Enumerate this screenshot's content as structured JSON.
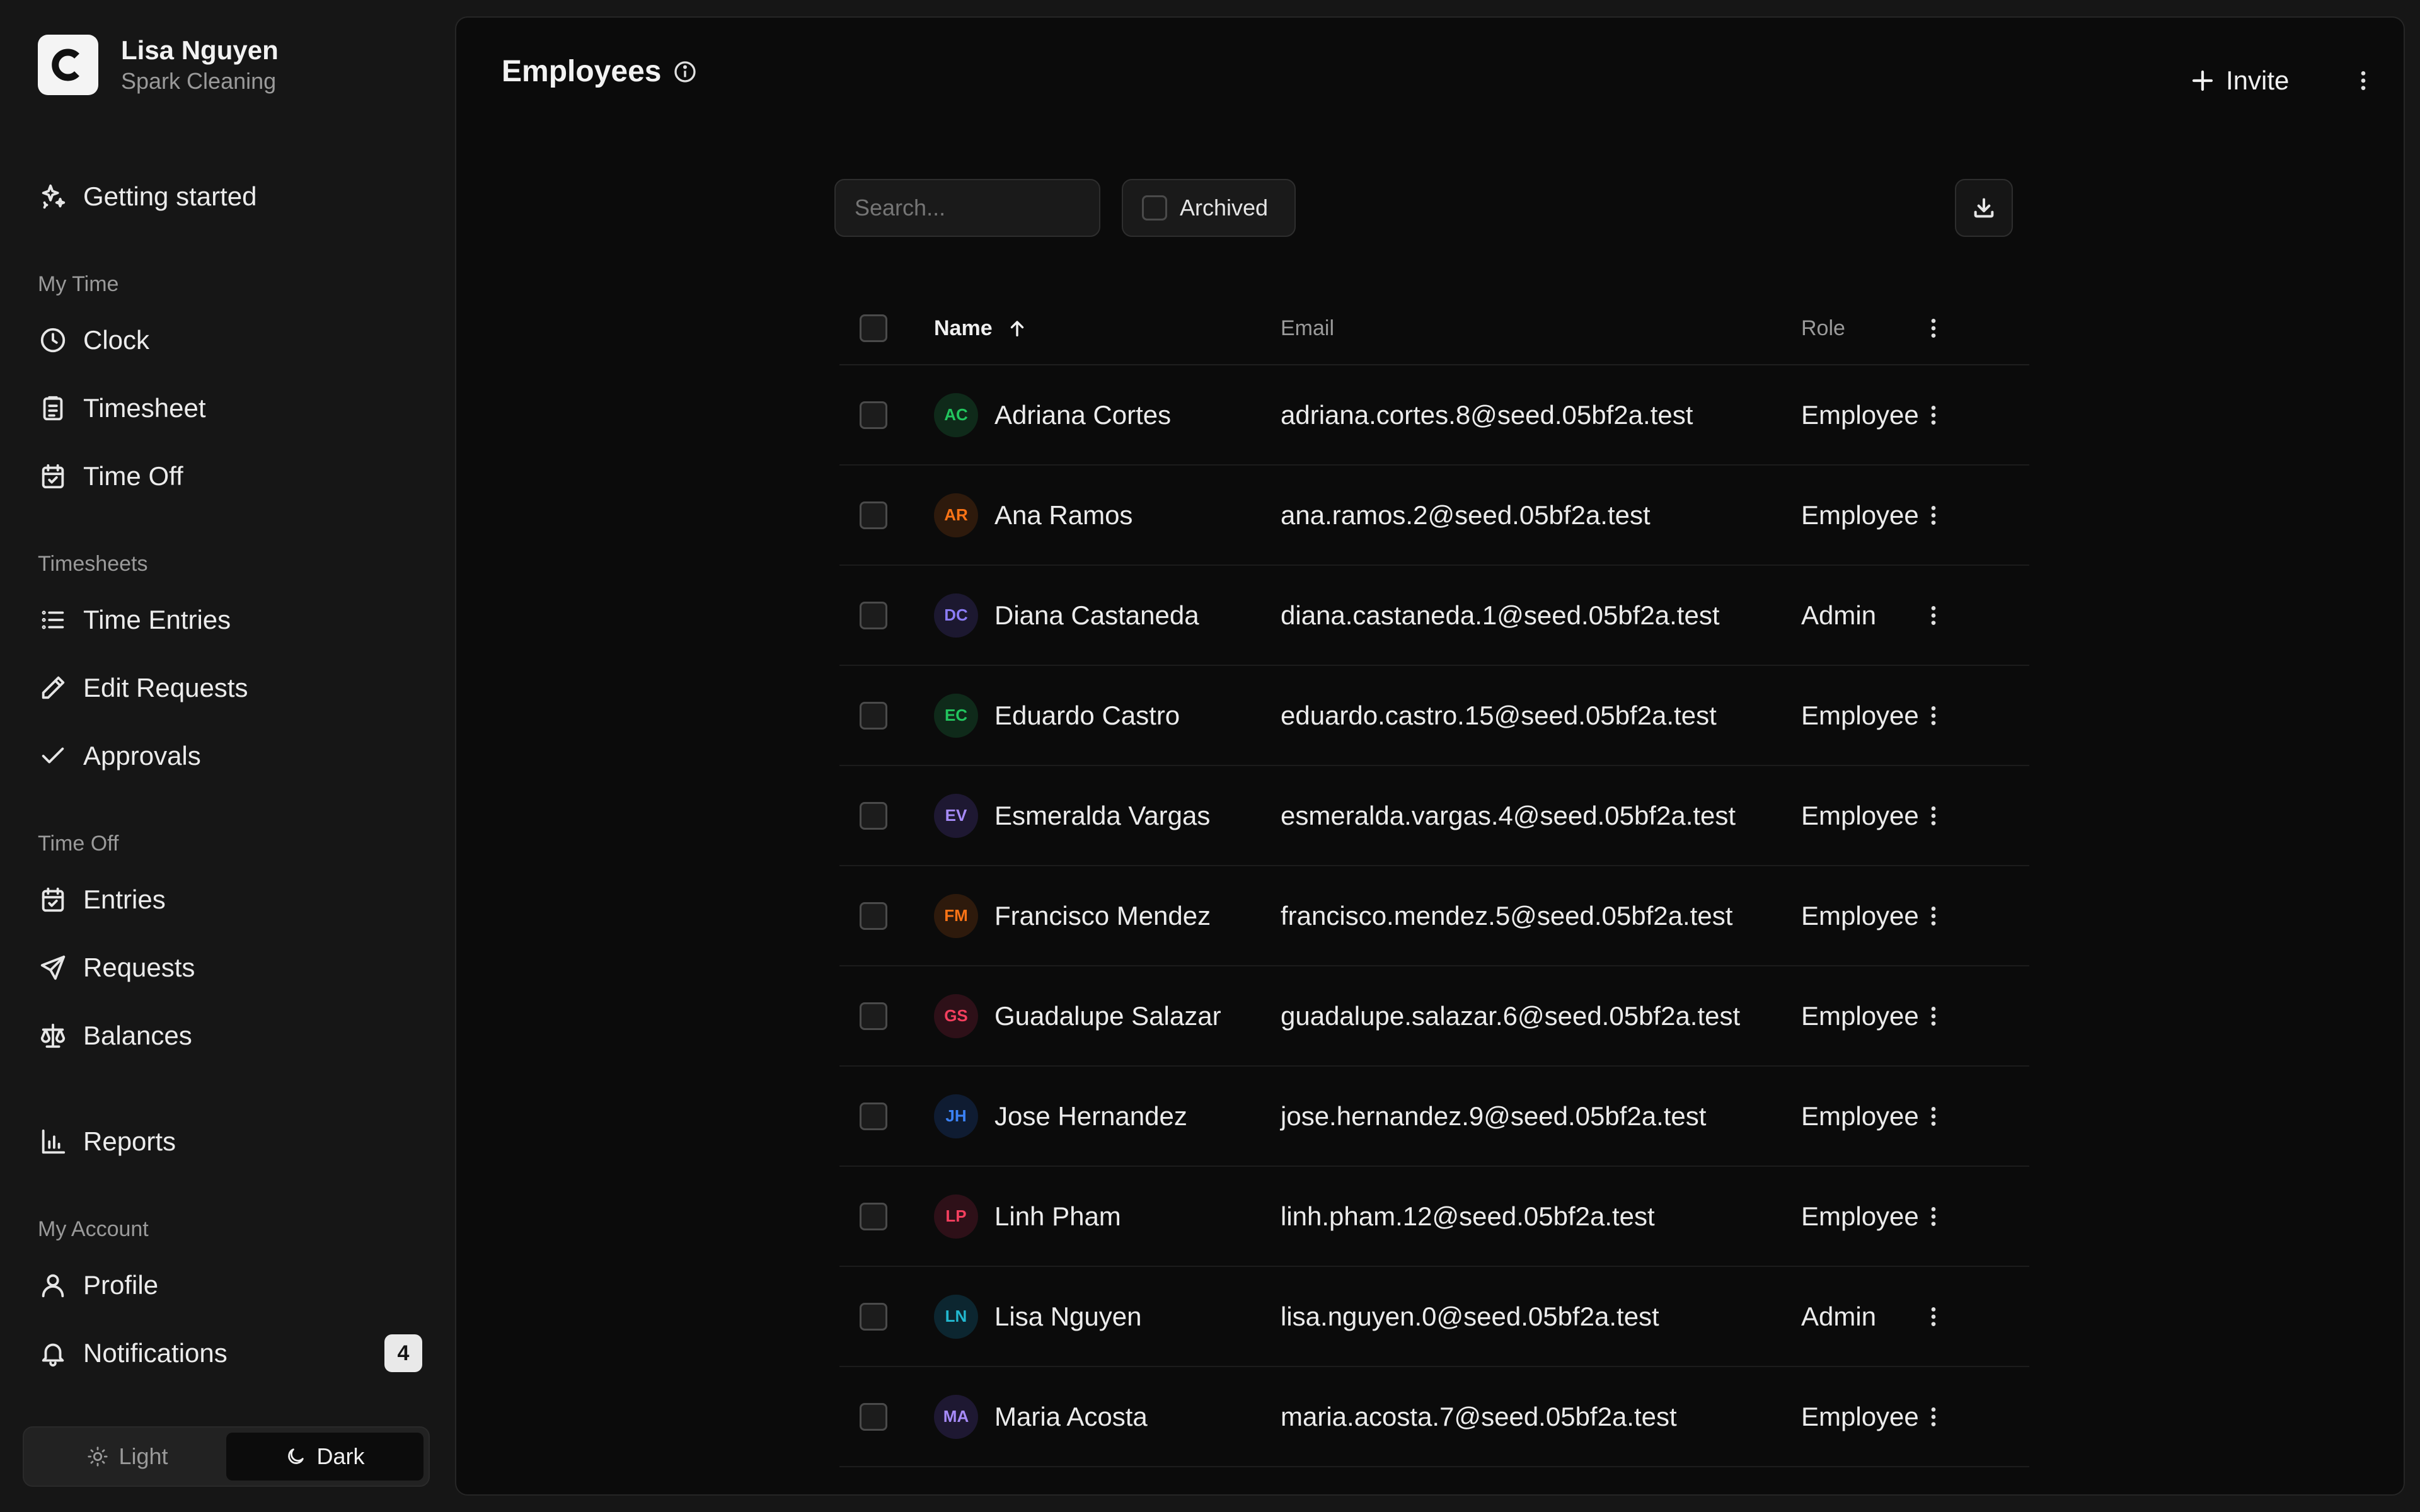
{
  "account": {
    "name": "Lisa Nguyen",
    "org": "Spark Cleaning",
    "logo_letter": "C"
  },
  "nav": {
    "getting_started": "Getting started",
    "my_time_label": "My Time",
    "clock": "Clock",
    "timesheet": "Timesheet",
    "time_off": "Time Off",
    "timesheets_label": "Timesheets",
    "time_entries": "Time Entries",
    "edit_requests": "Edit Requests",
    "approvals": "Approvals",
    "time_off_label": "Time Off",
    "entries": "Entries",
    "requests": "Requests",
    "balances": "Balances",
    "reports": "Reports",
    "my_account_label": "My Account",
    "profile": "Profile",
    "notifications": "Notifications",
    "notifications_count": "4"
  },
  "theme": {
    "light": "Light",
    "dark": "Dark",
    "selected": "Dark"
  },
  "page": {
    "title": "Employees",
    "invite_label": "Invite"
  },
  "toolbar": {
    "search_placeholder": "Search...",
    "archived_label": "Archived"
  },
  "table": {
    "headers": {
      "name": "Name",
      "email": "Email",
      "role": "Role"
    },
    "sort": {
      "column": "Name",
      "direction": "ascending"
    },
    "rows": [
      {
        "initials": "AC",
        "name": "Adriana Cortes",
        "email": "adriana.cortes.8@seed.05bf2a.test",
        "role": "Employee",
        "color": "#22c55e",
        "bg": "#0f2a1a"
      },
      {
        "initials": "AR",
        "name": "Ana Ramos",
        "email": "ana.ramos.2@seed.05bf2a.test",
        "role": "Employee",
        "color": "#f97316",
        "bg": "#2e1a0c"
      },
      {
        "initials": "DC",
        "name": "Diana Castaneda",
        "email": "diana.castaneda.1@seed.05bf2a.test",
        "role": "Admin",
        "color": "#8b7cf6",
        "bg": "#1c1830"
      },
      {
        "initials": "EC",
        "name": "Eduardo Castro",
        "email": "eduardo.castro.15@seed.05bf2a.test",
        "role": "Employee",
        "color": "#22c55e",
        "bg": "#0f2a1a"
      },
      {
        "initials": "EV",
        "name": "Esmeralda Vargas",
        "email": "esmeralda.vargas.4@seed.05bf2a.test",
        "role": "Employee",
        "color": "#a78bfa",
        "bg": "#1e1832"
      },
      {
        "initials": "FM",
        "name": "Francisco Mendez",
        "email": "francisco.mendez.5@seed.05bf2a.test",
        "role": "Employee",
        "color": "#f97316",
        "bg": "#2e1a0c"
      },
      {
        "initials": "GS",
        "name": "Guadalupe Salazar",
        "email": "guadalupe.salazar.6@seed.05bf2a.test",
        "role": "Employee",
        "color": "#f43f5e",
        "bg": "#2e1018"
      },
      {
        "initials": "JH",
        "name": "Jose Hernandez",
        "email": "jose.hernandez.9@seed.05bf2a.test",
        "role": "Employee",
        "color": "#3b82f6",
        "bg": "#0f1c32"
      },
      {
        "initials": "LP",
        "name": "Linh Pham",
        "email": "linh.pham.12@seed.05bf2a.test",
        "role": "Employee",
        "color": "#f43f5e",
        "bg": "#2e1018"
      },
      {
        "initials": "LN",
        "name": "Lisa Nguyen",
        "email": "lisa.nguyen.0@seed.05bf2a.test",
        "role": "Admin",
        "color": "#22b8cf",
        "bg": "#0c2630"
      },
      {
        "initials": "MA",
        "name": "Maria Acosta",
        "email": "maria.acosta.7@seed.05bf2a.test",
        "role": "Employee",
        "color": "#a78bfa",
        "bg": "#1e1832"
      }
    ]
  }
}
